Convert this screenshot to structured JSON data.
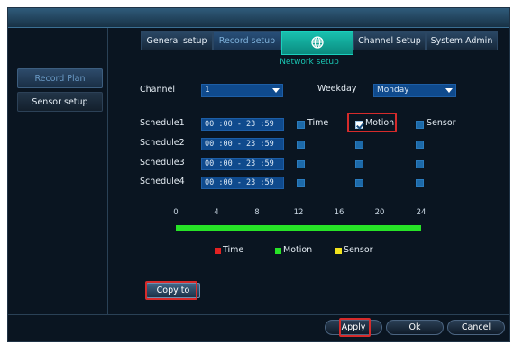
{
  "sidebar": {
    "items": [
      {
        "label": "Record Plan",
        "active": true
      },
      {
        "label": "Sensor setup",
        "active": false
      }
    ]
  },
  "tabs": [
    {
      "label": "General setup"
    },
    {
      "label": "Record setup"
    },
    {
      "label": "Network setup",
      "icon": "globe-icon",
      "active": true
    },
    {
      "label": "Channel Setup"
    },
    {
      "label": "System Admin"
    }
  ],
  "form": {
    "channel_label": "Channel",
    "channel_value": "1",
    "weekday_label": "Weekday",
    "weekday_value": "Monday"
  },
  "schedules": [
    {
      "label": "Schedule1",
      "time": "00 :00 - 23 :59"
    },
    {
      "label": "Schedule2",
      "time": "00 :00 - 23 :59"
    },
    {
      "label": "Schedule3",
      "time": "00 :00 - 23 :59"
    },
    {
      "label": "Schedule4",
      "time": "00 :00 - 23 :59"
    }
  ],
  "types": {
    "time": "Time",
    "motion": "Motion",
    "sensor": "Sensor"
  },
  "checked": {
    "schedule1": {
      "time": false,
      "motion": true,
      "sensor": false
    }
  },
  "timeline": {
    "ticks": [
      "0",
      "4",
      "8",
      "12",
      "16",
      "20",
      "24"
    ],
    "fill_fraction": 1.0,
    "fill_color": "#27e327"
  },
  "legend": [
    {
      "label": "Time",
      "color": "#e32222"
    },
    {
      "label": "Motion",
      "color": "#27e327"
    },
    {
      "label": "Sensor",
      "color": "#f2e31e"
    }
  ],
  "buttons": {
    "copy_to": "Copy to",
    "apply": "Apply",
    "ok": "Ok",
    "cancel": "Cancel"
  }
}
